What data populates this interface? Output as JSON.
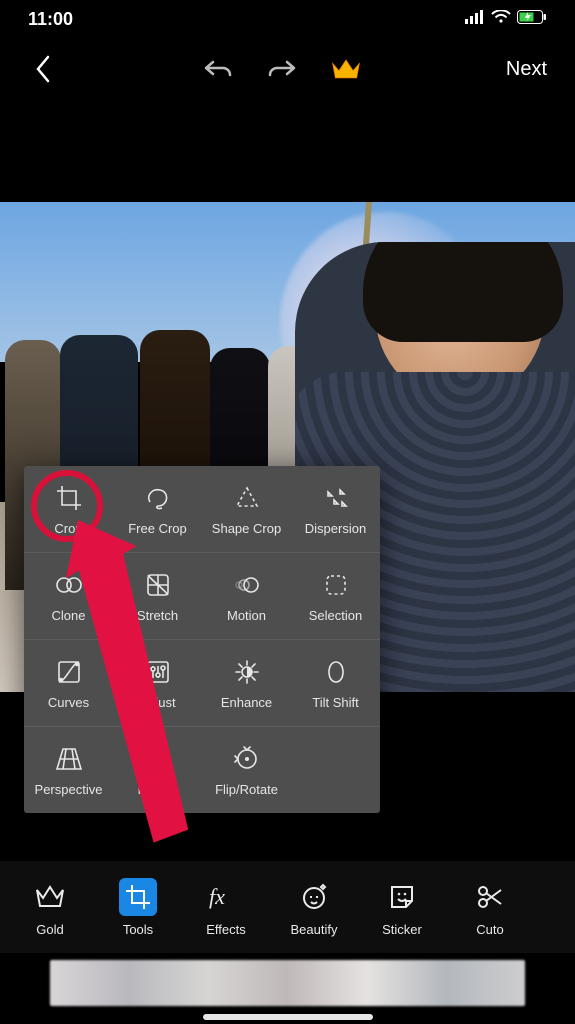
{
  "status": {
    "time": "11:00"
  },
  "nav": {
    "next_label": "Next"
  },
  "tools_panel": {
    "rows": [
      [
        {
          "label": "Crop"
        },
        {
          "label": "Free Crop"
        },
        {
          "label": "Shape Crop"
        },
        {
          "label": "Dispersion"
        }
      ],
      [
        {
          "label": "Clone"
        },
        {
          "label": "Stretch"
        },
        {
          "label": "Motion"
        },
        {
          "label": "Selection"
        }
      ],
      [
        {
          "label": "Curves"
        },
        {
          "label": "Adjust"
        },
        {
          "label": "Enhance"
        },
        {
          "label": "Tilt Shift"
        }
      ],
      [
        {
          "label": "Perspective"
        },
        {
          "label": "Resize"
        },
        {
          "label": "Flip/Rotate"
        },
        {
          "label": ""
        }
      ]
    ]
  },
  "bottom_bar": {
    "items": [
      {
        "label": "Gold"
      },
      {
        "label": "Tools"
      },
      {
        "label": "Effects"
      },
      {
        "label": "Beautify"
      },
      {
        "label": "Sticker"
      },
      {
        "label": "Cuto"
      }
    ],
    "active_index": 1
  },
  "annotation": {
    "highlighted_tool": "Crop"
  }
}
